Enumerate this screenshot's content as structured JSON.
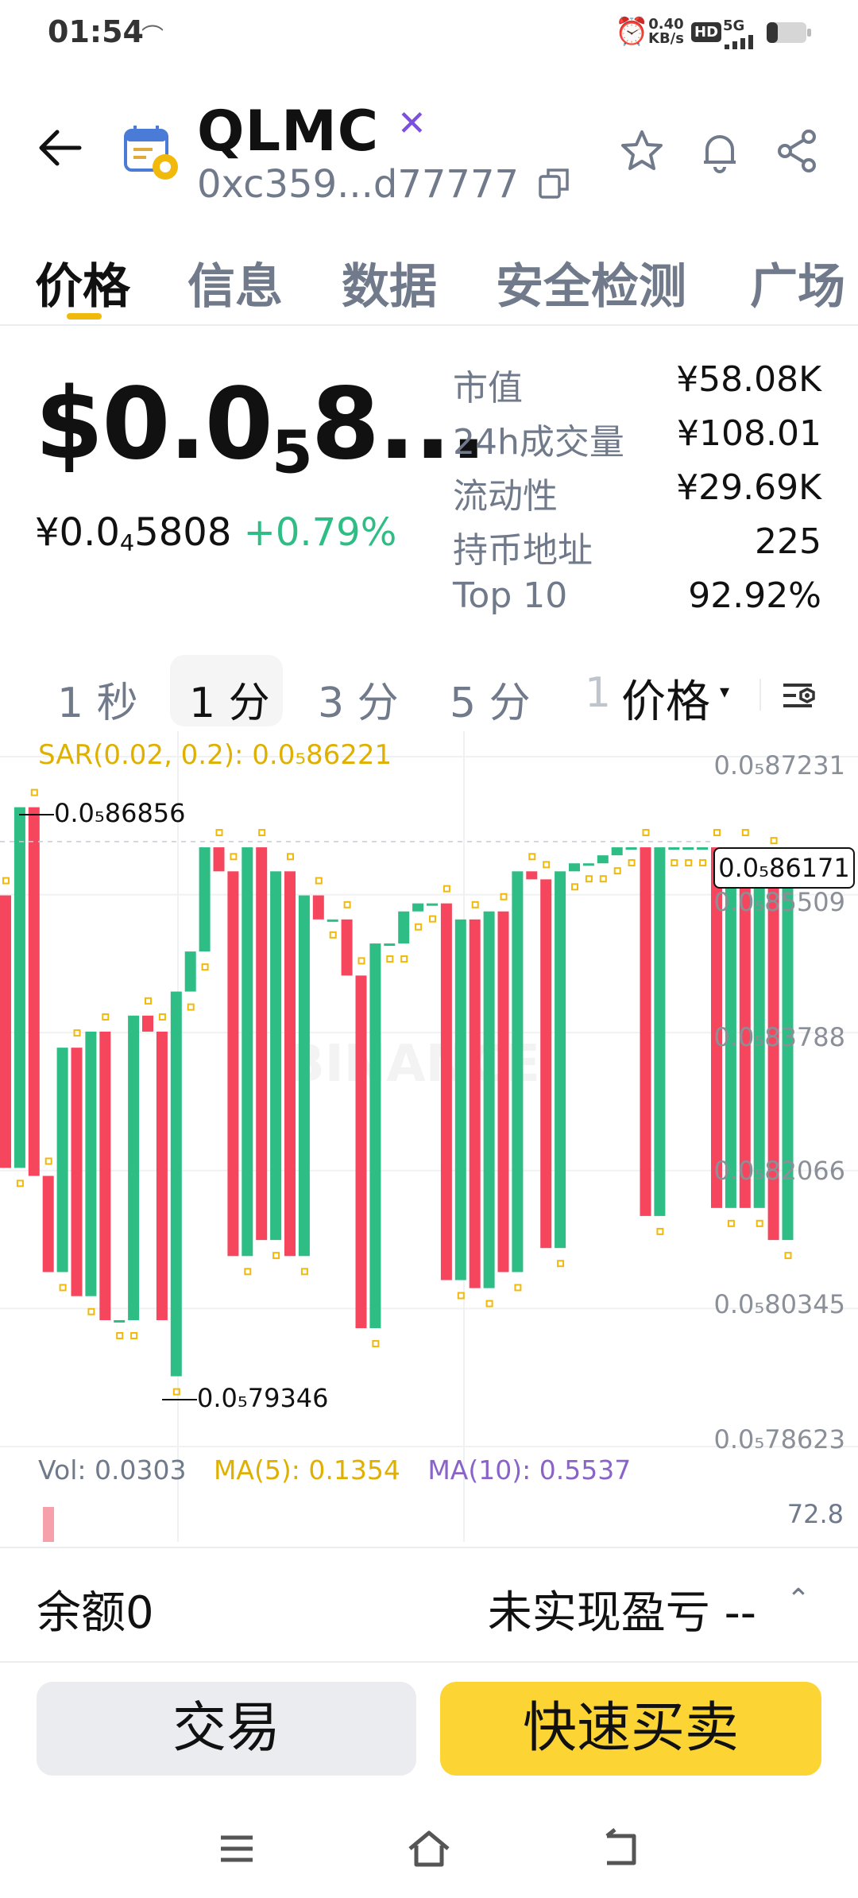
{
  "status_bar": {
    "time": "01:54",
    "net_speed_value": "0.40",
    "net_speed_unit": "KB/s",
    "hd_badge": "HD",
    "network": "5G",
    "icons": [
      "cast-icon",
      "alarm-icon",
      "signal-icon",
      "battery-icon"
    ]
  },
  "header": {
    "symbol": "QLMC",
    "address": "0xc359...d77777",
    "chain_badge_icon": "butterfly-icon",
    "icons": [
      "back-arrow-icon",
      "token-logo-icon",
      "copy-icon",
      "star-icon",
      "bell-icon",
      "share-icon"
    ]
  },
  "tabs": [
    {
      "label": "价格",
      "active": true
    },
    {
      "label": "信息"
    },
    {
      "label": "数据"
    },
    {
      "label": "安全检测"
    },
    {
      "label": "广场"
    }
  ],
  "price": {
    "usd_prefix": "$0.0",
    "usd_sub": "5",
    "usd_tail": "8...",
    "cny_prefix": "¥0.0",
    "cny_sub": "4",
    "cny_tail": "5808",
    "change": "+0.79%"
  },
  "stats": [
    {
      "label": "市值",
      "value": "¥58.08K"
    },
    {
      "label": "24h成交量",
      "value": "¥108.01"
    },
    {
      "label": "流动性",
      "value": "¥29.69K"
    },
    {
      "label": "持币地址",
      "value": "225"
    },
    {
      "label": "Top 10",
      "value": "92.92%"
    }
  ],
  "intervals": {
    "items": [
      {
        "label": "1 秒"
      },
      {
        "label": "1 分",
        "active": true
      },
      {
        "label": "3 分"
      },
      {
        "label": "5 分"
      },
      {
        "label": "1"
      }
    ],
    "chart_type": "价格",
    "chart_type_caret": "▾"
  },
  "indicators": {
    "sar": "SAR(0.02, 0.2): 0.0₅86221",
    "vol": "Vol: 0.0303",
    "ma5": "MA(5): 0.1354",
    "ma10": "MA(10): 0.5537",
    "vol_axis": "72.8"
  },
  "watermark": "BINANCE",
  "chart_data": {
    "type": "candlestick",
    "price_axis": [
      "0.0₅87231",
      "0.0₅85509",
      "0.0₅83788",
      "0.0₅82066",
      "0.0₅80345",
      "0.0₅78623"
    ],
    "high_label": "0.0₅86856",
    "low_label": "0.0₅79346",
    "current_price": "0.0₅86171",
    "ylim": [
      7.8623e-06,
      8.7231e-06
    ],
    "candles": [
      {
        "o": 8.55e-06,
        "c": 8.21e-06
      },
      {
        "o": 8.21e-06,
        "c": 8.66e-06
      },
      {
        "o": 8.66e-06,
        "c": 8.2e-06
      },
      {
        "o": 8.2e-06,
        "c": 8.08e-06
      },
      {
        "o": 8.08e-06,
        "c": 8.36e-06
      },
      {
        "o": 8.36e-06,
        "c": 8.05e-06
      },
      {
        "o": 8.05e-06,
        "c": 8.38e-06
      },
      {
        "o": 8.38e-06,
        "c": 8.02e-06
      },
      {
        "o": 8.02e-06,
        "c": 8.02e-06
      },
      {
        "o": 8.02e-06,
        "c": 8.4e-06
      },
      {
        "o": 8.4e-06,
        "c": 8.38e-06
      },
      {
        "o": 8.38e-06,
        "c": 8.02e-06
      },
      {
        "o": 7.95e-06,
        "c": 8.43e-06
      },
      {
        "o": 8.43e-06,
        "c": 8.48e-06
      },
      {
        "o": 8.48e-06,
        "c": 8.61e-06
      },
      {
        "o": 8.61e-06,
        "c": 8.58e-06
      },
      {
        "o": 8.58e-06,
        "c": 8.1e-06
      },
      {
        "o": 8.1e-06,
        "c": 8.61e-06
      },
      {
        "o": 8.61e-06,
        "c": 8.12e-06
      },
      {
        "o": 8.12e-06,
        "c": 8.58e-06
      },
      {
        "o": 8.58e-06,
        "c": 8.1e-06
      },
      {
        "o": 8.1e-06,
        "c": 8.55e-06
      },
      {
        "o": 8.55e-06,
        "c": 8.52e-06
      },
      {
        "o": 8.52e-06,
        "c": 8.52e-06
      },
      {
        "o": 8.52e-06,
        "c": 8.45e-06
      },
      {
        "o": 8.45e-06,
        "c": 8.01e-06
      },
      {
        "o": 8.01e-06,
        "c": 8.49e-06
      },
      {
        "o": 8.49e-06,
        "c": 8.49e-06
      },
      {
        "o": 8.49e-06,
        "c": 8.53e-06
      },
      {
        "o": 8.53e-06,
        "c": 8.54e-06
      },
      {
        "o": 8.54e-06,
        "c": 8.54e-06
      },
      {
        "o": 8.54e-06,
        "c": 8.07e-06
      },
      {
        "o": 8.07e-06,
        "c": 8.52e-06
      },
      {
        "o": 8.52e-06,
        "c": 8.06e-06
      },
      {
        "o": 8.06e-06,
        "c": 8.53e-06
      },
      {
        "o": 8.53e-06,
        "c": 8.08e-06
      },
      {
        "o": 8.08e-06,
        "c": 8.58e-06
      },
      {
        "o": 8.58e-06,
        "c": 8.57e-06
      },
      {
        "o": 8.57e-06,
        "c": 8.11e-06
      },
      {
        "o": 8.11e-06,
        "c": 8.58e-06
      },
      {
        "o": 8.58e-06,
        "c": 8.59e-06
      },
      {
        "o": 8.59e-06,
        "c": 8.59e-06
      },
      {
        "o": 8.59e-06,
        "c": 8.6e-06
      },
      {
        "o": 8.6e-06,
        "c": 8.61e-06
      },
      {
        "o": 8.61e-06,
        "c": 8.61e-06
      },
      {
        "o": 8.61e-06,
        "c": 8.15e-06
      },
      {
        "o": 8.15e-06,
        "c": 8.61e-06
      },
      {
        "o": 8.61e-06,
        "c": 8.61e-06
      },
      {
        "o": 8.61e-06,
        "c": 8.61e-06
      },
      {
        "o": 8.61e-06,
        "c": 8.61e-06
      },
      {
        "o": 8.61e-06,
        "c": 8.16e-06
      },
      {
        "o": 8.16e-06,
        "c": 8.61e-06
      },
      {
        "o": 8.61e-06,
        "c": 8.16e-06
      },
      {
        "o": 8.16e-06,
        "c": 8.6e-06
      },
      {
        "o": 8.6e-06,
        "c": 8.12e-06
      },
      {
        "o": 8.12e-06,
        "c": 8.58e-06
      }
    ]
  },
  "bottom": {
    "balance": "余额0",
    "pnl": "未实现盈亏 --",
    "pnl_caret": "⌃",
    "trade_label": "交易",
    "quick_label": "快速买卖"
  },
  "colors": {
    "up": "#2ebd85",
    "down": "#f6465d",
    "sar": "#f0b90b",
    "accent": "#fcd535"
  }
}
